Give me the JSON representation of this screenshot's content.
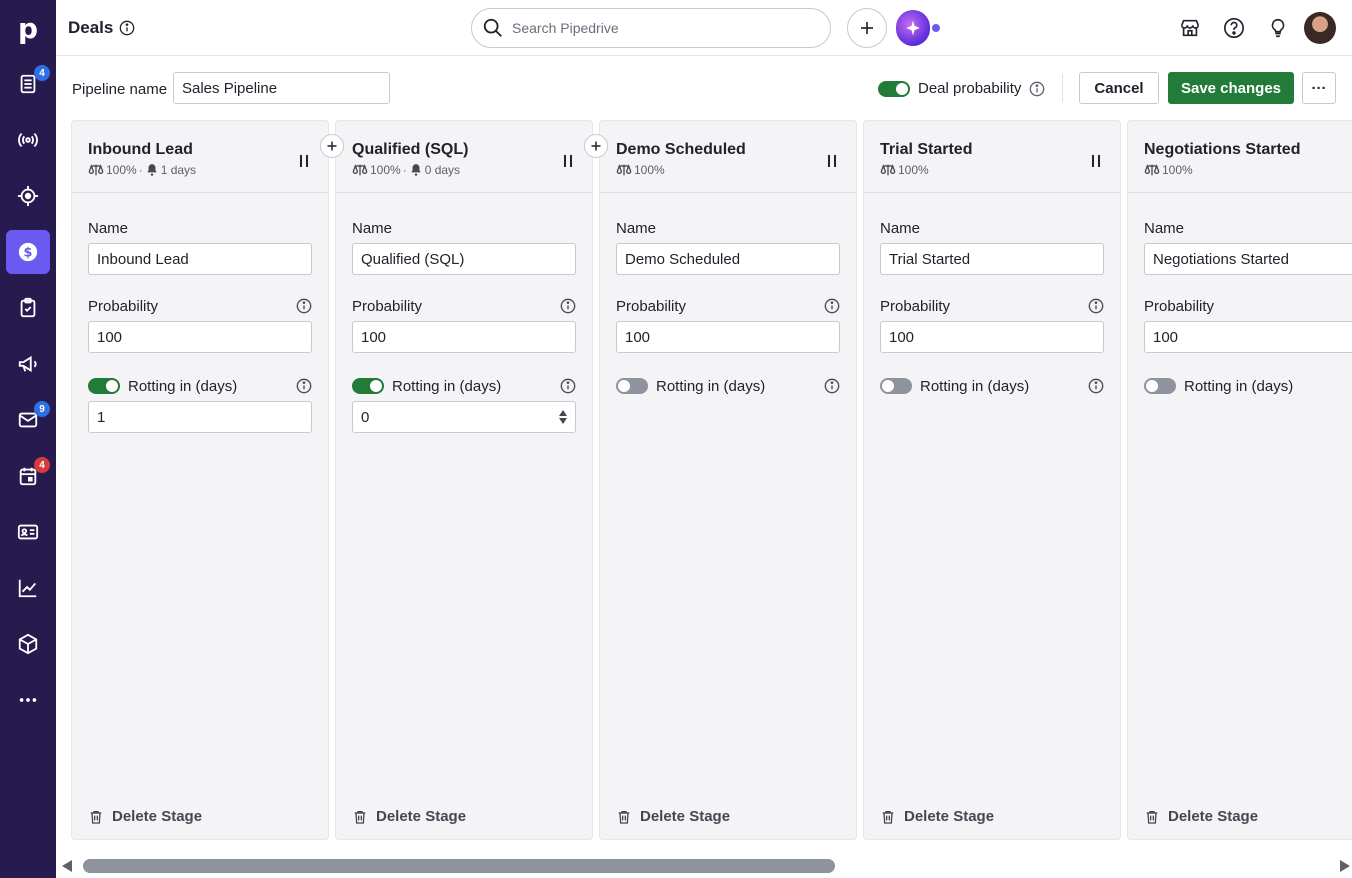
{
  "app": {
    "logo": "p"
  },
  "header": {
    "title": "Deals"
  },
  "search": {
    "placeholder": "Search Pipedrive"
  },
  "sidebar": {
    "items": [
      {
        "name": "leads",
        "badge": "4",
        "badge_color": "#2f6fe4"
      },
      {
        "name": "campaigns"
      },
      {
        "name": "projects"
      },
      {
        "name": "deals",
        "active": true
      },
      {
        "name": "activities"
      },
      {
        "name": "marketing"
      },
      {
        "name": "mail",
        "badge": "9",
        "badge_color": "#2f6fe4"
      },
      {
        "name": "calendar",
        "badge": "4",
        "badge_color": "#d63b3b"
      },
      {
        "name": "contacts"
      },
      {
        "name": "insights"
      },
      {
        "name": "products"
      },
      {
        "name": "more"
      }
    ]
  },
  "pipeline": {
    "name_label": "Pipeline name",
    "name_value": "Sales Pipeline",
    "deal_probability_label": "Deal probability",
    "deal_probability_on": true,
    "cancel_label": "Cancel",
    "save_label": "Save changes",
    "more_label": "···"
  },
  "stage_labels": {
    "name": "Name",
    "probability": "Probability",
    "rotting": "Rotting in (days)",
    "delete": "Delete Stage"
  },
  "stages": [
    {
      "title": "Inbound Lead",
      "prob_meta": "100%",
      "rot_meta": "1 days",
      "name": "Inbound Lead",
      "probability": "100",
      "rotting_on": true,
      "rotting_days": "1"
    },
    {
      "title": "Qualified (SQL)",
      "prob_meta": "100%",
      "rot_meta": "0 days",
      "name": "Qualified (SQL)",
      "probability": "100",
      "rotting_on": true,
      "rotting_days": "0"
    },
    {
      "title": "Demo Scheduled",
      "prob_meta": "100%",
      "name": "Demo Scheduled",
      "probability": "100",
      "rotting_on": false
    },
    {
      "title": "Trial Started",
      "prob_meta": "100%",
      "name": "Trial Started",
      "probability": "100",
      "rotting_on": false
    },
    {
      "title": "Negotiations Started",
      "prob_meta": "100%",
      "name": "Negotiations Started",
      "probability": "100",
      "rotting_on": false
    }
  ],
  "colors": {
    "sidebar": "#261a4f",
    "accent": "#6a5af0",
    "primary_green": "#237b3a"
  }
}
